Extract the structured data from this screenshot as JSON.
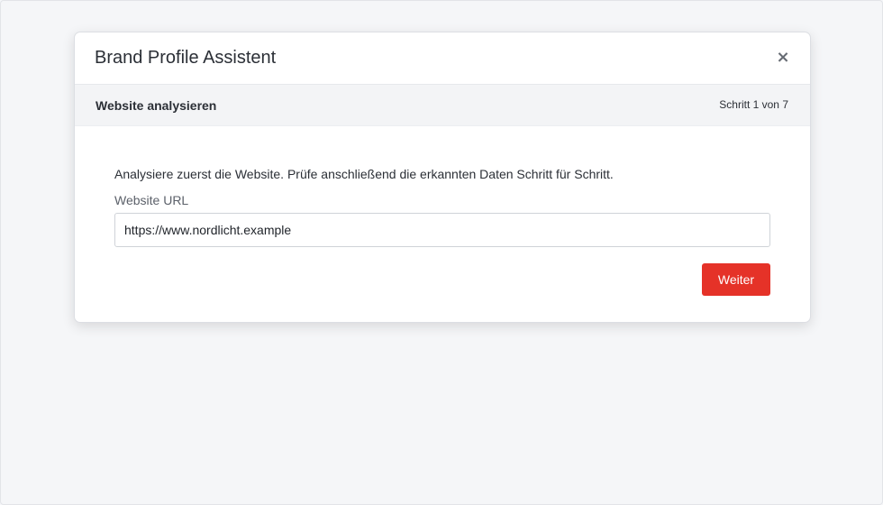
{
  "modal": {
    "title": "Brand Profile Assistent",
    "close_icon": "close-icon",
    "close_glyph": "×"
  },
  "step": {
    "title": "Website analysieren",
    "counter": "Schritt 1 von 7"
  },
  "body": {
    "intro": "Analysiere zuerst die Website. Prüfe anschließend die erkannten Daten Schritt für Schritt.",
    "url_label": "Website URL",
    "url_value": "https://www.nordlicht.example",
    "next_label": "Weiter"
  },
  "colors": {
    "accent": "#e53228",
    "background": "#f5f6f8",
    "step_bar": "#f3f4f6"
  }
}
